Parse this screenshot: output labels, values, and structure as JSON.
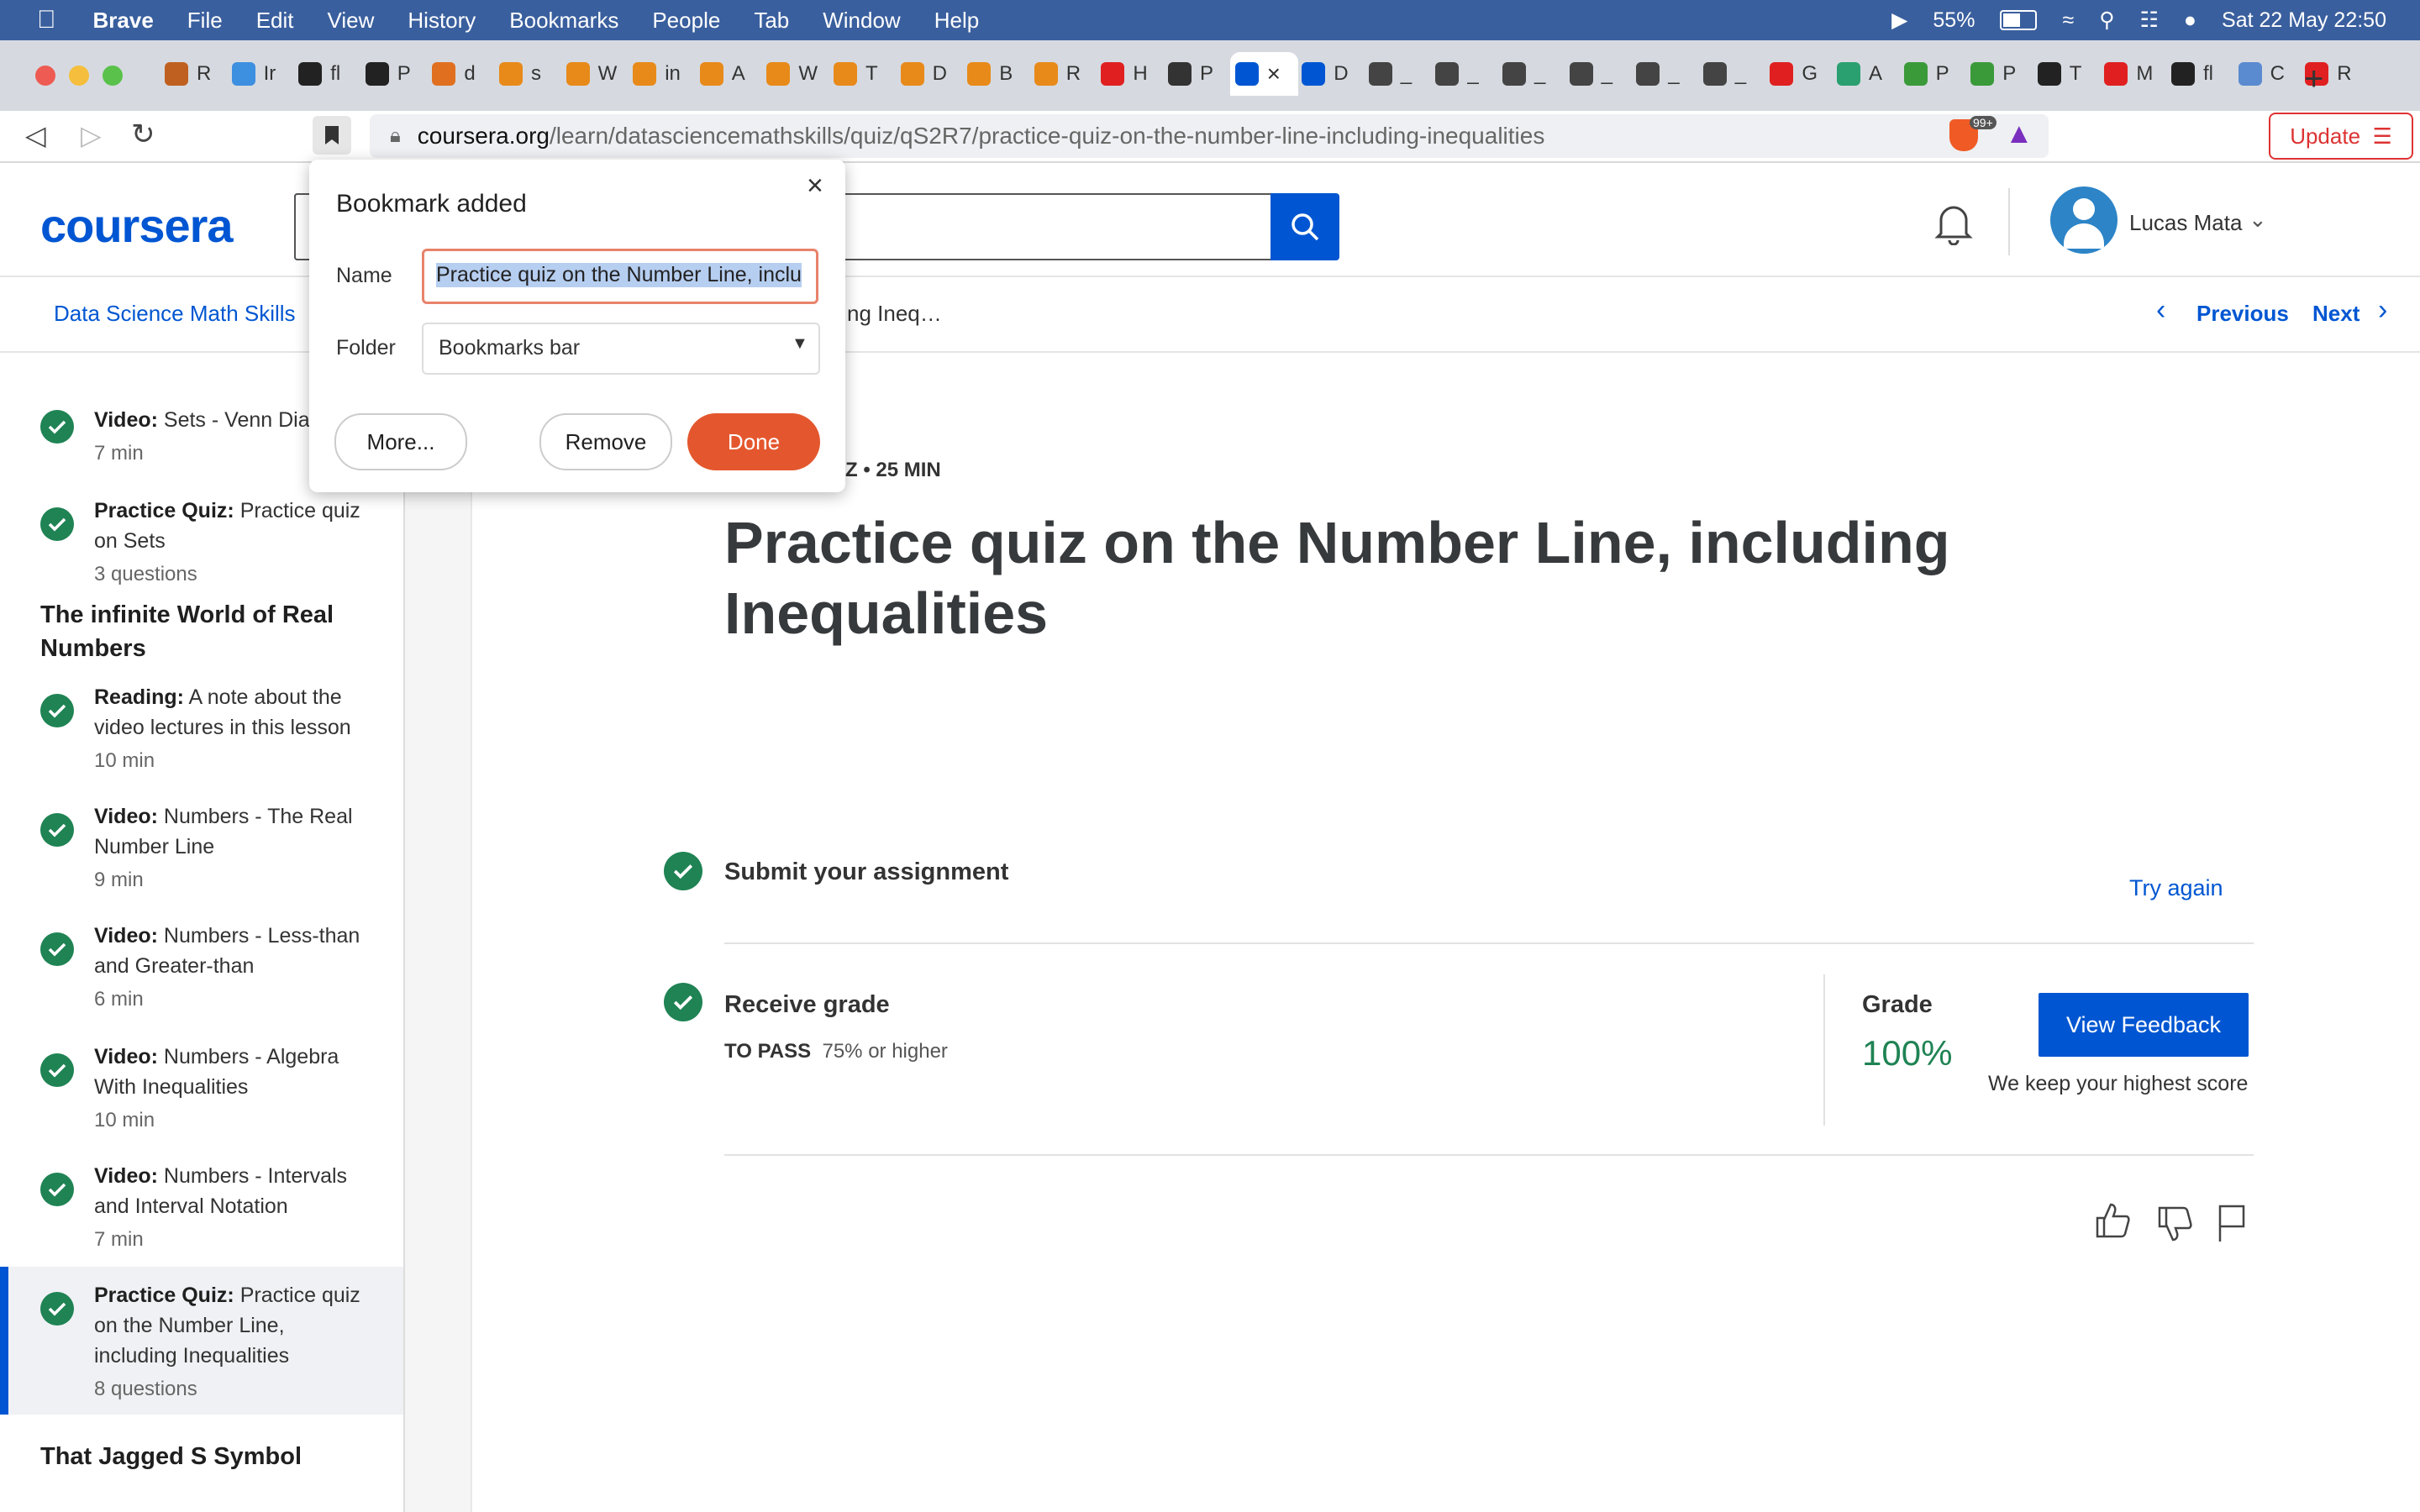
{
  "menubar": {
    "app": "Brave",
    "items": [
      "File",
      "Edit",
      "View",
      "History",
      "Bookmarks",
      "People",
      "Tab",
      "Window",
      "Help"
    ],
    "battery": "55%",
    "datetime": "Sat 22 May  22:50"
  },
  "tabs": [
    {
      "label": "R",
      "fav_color": "#c06020"
    },
    {
      "label": "Ir",
      "fav_color": "#3d8fe0"
    },
    {
      "label": "fl",
      "fav_color": "#222222"
    },
    {
      "label": "P",
      "fav_color": "#222222"
    },
    {
      "label": "d",
      "fav_color": "#e07020"
    },
    {
      "label": "s",
      "fav_color": "#e88a1a"
    },
    {
      "label": "W",
      "fav_color": "#e88a1a"
    },
    {
      "label": "in",
      "fav_color": "#e88a1a"
    },
    {
      "label": "A",
      "fav_color": "#e88a1a"
    },
    {
      "label": "W",
      "fav_color": "#e88a1a"
    },
    {
      "label": "T",
      "fav_color": "#e88a1a"
    },
    {
      "label": "D",
      "fav_color": "#e88a1a"
    },
    {
      "label": "B",
      "fav_color": "#e88a1a"
    },
    {
      "label": "R",
      "fav_color": "#e88a1a"
    },
    {
      "label": "H",
      "fav_color": "#e02020"
    },
    {
      "label": "P",
      "fav_color": "#333333"
    },
    {
      "label": "",
      "fav_color": "#0056d2",
      "active": true
    },
    {
      "label": "D",
      "fav_color": "#0056d2"
    },
    {
      "label": "_",
      "fav_color": "#444444"
    },
    {
      "label": "_",
      "fav_color": "#444444"
    },
    {
      "label": "_",
      "fav_color": "#444444"
    },
    {
      "label": "_",
      "fav_color": "#444444"
    },
    {
      "label": "_",
      "fav_color": "#444444"
    },
    {
      "label": "_",
      "fav_color": "#444444"
    },
    {
      "label": "G",
      "fav_color": "#e02020"
    },
    {
      "label": "A",
      "fav_color": "#2aa070"
    },
    {
      "label": "P",
      "fav_color": "#3a9a3a"
    },
    {
      "label": "P",
      "fav_color": "#3a9a3a"
    },
    {
      "label": "T",
      "fav_color": "#222222"
    },
    {
      "label": "M",
      "fav_color": "#e02020"
    },
    {
      "label": "fl",
      "fav_color": "#222222"
    },
    {
      "label": "C",
      "fav_color": "#5a8ad0"
    },
    {
      "label": "R",
      "fav_color": "#e02020"
    }
  ],
  "toolbar": {
    "url_host": "coursera.org",
    "url_path": "/learn/datasciencemathskills/quiz/qS2R7/practice-quiz-on-the-number-line-including-inequalities",
    "shield_badge": "99+",
    "update_label": "Update"
  },
  "header": {
    "logo": "coursera",
    "user_name": "Lucas Mata"
  },
  "breadcrumb": {
    "course": "Data Science Math Skills",
    "current": "ng Ineq…",
    "previous": "Previous",
    "next": "Next"
  },
  "sidebar": {
    "items": [
      {
        "type": "Video:",
        "title": "Sets - Venn Diagrams",
        "meta": "7 min"
      },
      {
        "type": "Practice Quiz:",
        "title": "Practice quiz on Sets",
        "meta": "3 questions"
      }
    ],
    "section1": "The infinite World of Real Numbers",
    "items2": [
      {
        "type": "Reading:",
        "title": "A note about the video lectures in this lesson",
        "meta": "10 min"
      },
      {
        "type": "Video:",
        "title": "Numbers - The Real Number Line",
        "meta": "9 min"
      },
      {
        "type": "Video:",
        "title": "Numbers - Less-than and Greater-than",
        "meta": "6 min"
      },
      {
        "type": "Video:",
        "title": "Numbers - Algebra With Inequalities",
        "meta": "10 min"
      },
      {
        "type": "Video:",
        "title": "Numbers - Intervals and Interval Notation",
        "meta": "7 min"
      },
      {
        "type": "Practice Quiz:",
        "title": "Practice quiz on the Number Line, including Inequalities",
        "meta": "8 questions"
      }
    ],
    "section2": "That Jagged S Symbol"
  },
  "main": {
    "meta_label": "UIZ • 25 MIN",
    "title": "Practice quiz on the Number Line, including Inequalities",
    "submit_label": "Submit your assignment",
    "try_again": "Try again",
    "receive_label": "Receive grade",
    "to_pass_label": "TO PASS",
    "to_pass_value": "75% or higher",
    "grade_label": "Grade",
    "grade_value": "100%",
    "view_feedback": "View Feedback",
    "highest_note": "We keep your highest score"
  },
  "popup": {
    "title": "Bookmark added",
    "name_label": "Name",
    "name_value": "Practice quiz on the Number Line, inclu",
    "folder_label": "Folder",
    "folder_value": "Bookmarks bar",
    "more_label": "More...",
    "remove_label": "Remove",
    "done_label": "Done"
  },
  "colors": {
    "brand": "#0056d2",
    "success": "#1f8354",
    "done_button": "#e4572e"
  }
}
